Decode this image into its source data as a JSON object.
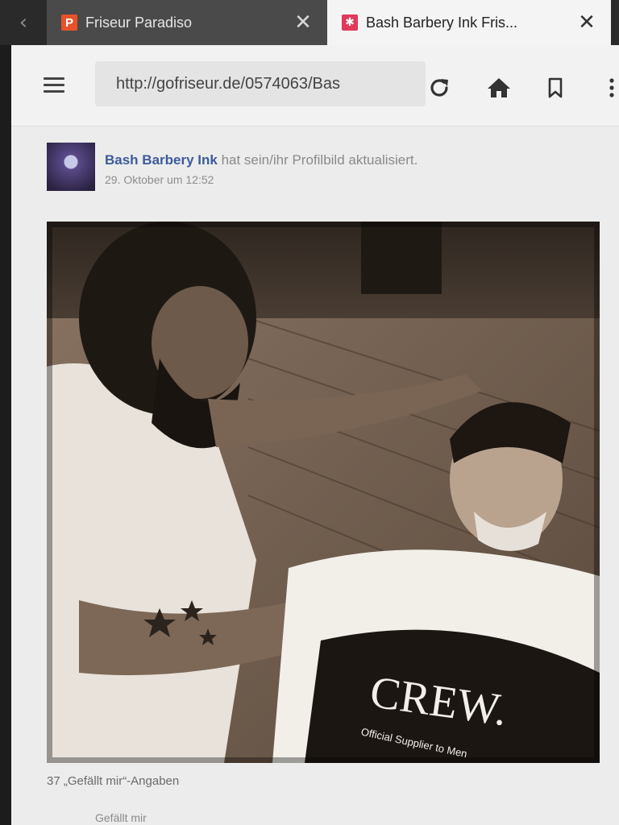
{
  "browser": {
    "tabs": [
      {
        "label": "Friseur Paradiso",
        "favicon_letter": "P",
        "favicon_color": "#e5532a",
        "active": false
      },
      {
        "label": "Bash Barbery Ink Fris...",
        "favicon_glyph": "✱",
        "favicon_color": "#e2385a",
        "active": true
      }
    ],
    "back_glyph": "‹",
    "close_glyph": "✕",
    "url": "http://gofriseur.de/0574063/Bas",
    "icons": [
      "menu-icon",
      "reload-icon",
      "home-icon",
      "bookmark-icon",
      "more-icon"
    ]
  },
  "post": {
    "author": "Bash Barbery Ink",
    "action": "hat sein/ihr Profilbild aktualisiert.",
    "timestamp": "29. Oktober um 12:52",
    "photo_text": "CREW.",
    "photo_subtext": "Official Supplier to Men",
    "likes": "37 „Gefällt mir“-Angaben",
    "like_button_label": "Gefällt mir"
  },
  "colors": {
    "link_blue": "#3b5b9c",
    "page_bg": "#ececec",
    "active_tab_bg": "#f4f4f4",
    "inactive_tab_bg": "#4a4a4a"
  }
}
